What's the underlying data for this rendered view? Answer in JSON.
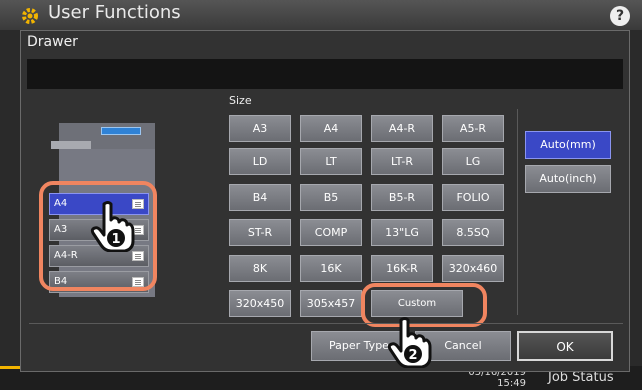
{
  "app": {
    "title": "User Functions"
  },
  "status": {
    "date": "05/16/2019",
    "time": "15:49",
    "job_status": "Job Status"
  },
  "dialog": {
    "title": "Drawer",
    "drawers": [
      {
        "label": "A4",
        "selected": true
      },
      {
        "label": "A3",
        "selected": false
      },
      {
        "label": "A4-R",
        "selected": false
      },
      {
        "label": "B4",
        "selected": false
      }
    ],
    "size_label": "Size",
    "sizes": [
      [
        "A3",
        "A4",
        "A4-R",
        "A5-R"
      ],
      [
        "LD",
        "LT",
        "LT-R",
        "LG"
      ],
      [
        "B4",
        "B5",
        "B5-R",
        "FOLIO"
      ],
      [
        "ST-R",
        "COMP",
        "13\"LG",
        "8.5SQ"
      ],
      [
        "8K",
        "16K",
        "16K-R",
        "320x460"
      ],
      [
        "320x450",
        "305x457",
        "Custom"
      ]
    ],
    "units": [
      {
        "label": "Auto(mm)",
        "selected": true
      },
      {
        "label": "Auto(inch)",
        "selected": false
      }
    ],
    "footer": {
      "paper_type": "Paper Type",
      "cancel": "Cancel",
      "ok": "OK"
    },
    "callouts": [
      "1",
      "2"
    ]
  },
  "colors": {
    "selected": "#3a48c6",
    "highlight": "#f08560",
    "button": "#7c7e84"
  }
}
